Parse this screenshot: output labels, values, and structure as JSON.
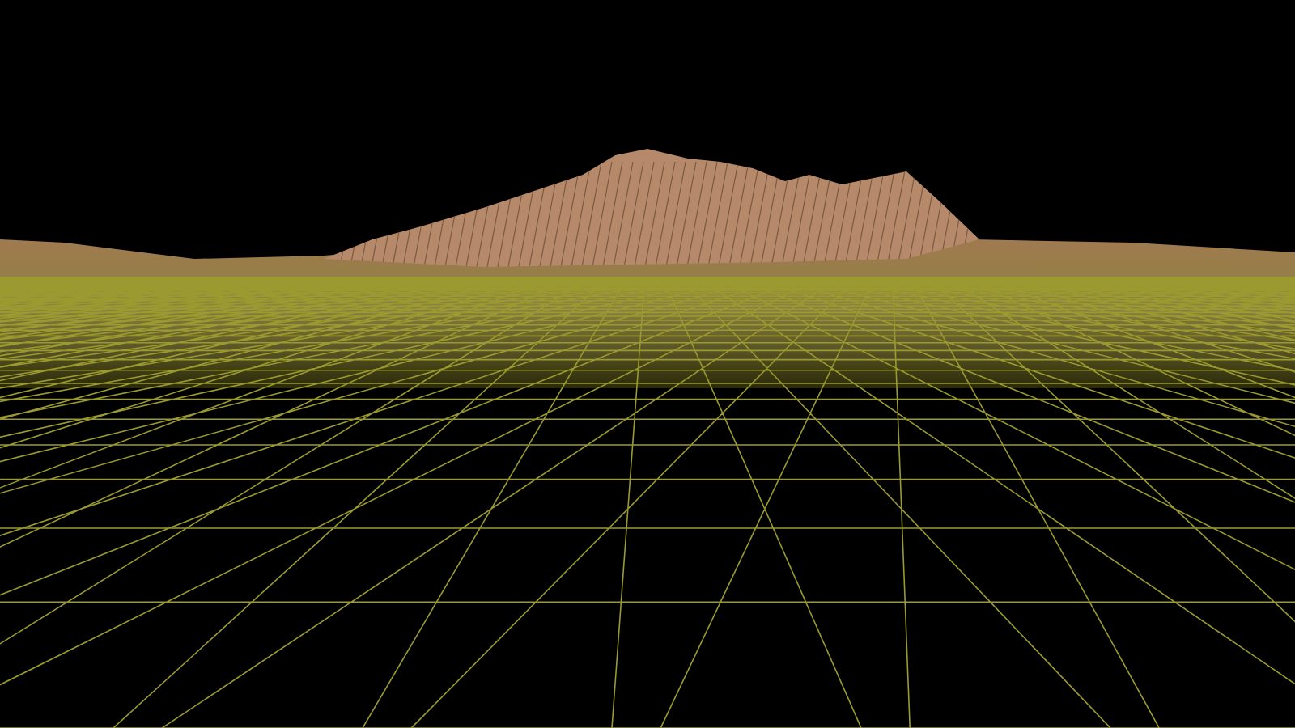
{
  "scene": {
    "kind": "wireframe-terrain"
  }
}
